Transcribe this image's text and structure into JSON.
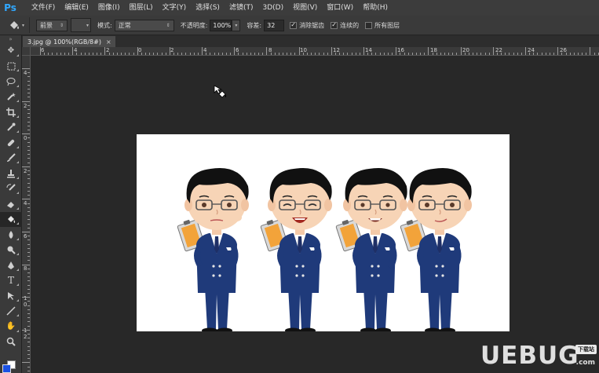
{
  "app": {
    "logo": "Ps"
  },
  "menu": [
    "文件(F)",
    "编辑(E)",
    "图像(I)",
    "图层(L)",
    "文字(Y)",
    "选择(S)",
    "滤镜(T)",
    "3D(D)",
    "视图(V)",
    "窗口(W)",
    "帮助(H)"
  ],
  "options": {
    "tool_icon": "paint-bucket-icon",
    "fill_source": "前景",
    "mode_label": "模式:",
    "mode_value": "正常",
    "opacity_label": "不透明度:",
    "opacity_value": "100%",
    "tolerance_label": "容差:",
    "tolerance_value": "32",
    "antialias_label": "消除锯齿",
    "antialias_checked": true,
    "contiguous_label": "连续的",
    "contiguous_checked": true,
    "all_layers_label": "所有图层",
    "all_layers_checked": false
  },
  "document": {
    "tab_title": "3.jpg @ 100%(RGB/8#)",
    "close_glyph": "×"
  },
  "ruler": {
    "top_labels": [
      "6",
      "4",
      "2",
      "0",
      "2",
      "4",
      "6",
      "8",
      "10",
      "12",
      "14",
      "16",
      "18",
      "20",
      "22",
      "24",
      "26"
    ],
    "left_labels": [
      "4",
      "2",
      "0",
      "2",
      "4",
      "6",
      "8",
      "1 0",
      "1 2"
    ]
  },
  "tools": [
    "move-icon",
    "marquee-icon",
    "lasso-icon",
    "magic-wand-icon",
    "crop-icon",
    "eyedropper-icon",
    "healing-brush-icon",
    "brush-icon",
    "clone-stamp-icon",
    "history-brush-icon",
    "eraser-icon",
    "paint-bucket-icon",
    "blur-icon",
    "dodge-icon",
    "pen-icon",
    "type-icon",
    "path-selection-icon",
    "line-icon",
    "hand-icon",
    "zoom-icon"
  ],
  "colors": {
    "foreground": "#1b51e3",
    "background": "#ffffff",
    "accent": "#31a8ff"
  },
  "watermark": {
    "brand": "UEBUG",
    "badge": "下载站",
    "domain": ".com"
  }
}
